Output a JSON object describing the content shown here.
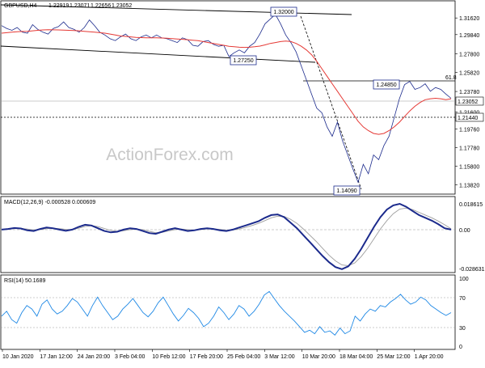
{
  "main_header": {
    "symbol": "GBPUSD,H4",
    "o": "1.22919",
    "h": "1.23071",
    "l": "1.22656",
    "c": "1.23052"
  },
  "watermark": "ActionForex.com",
  "price_axis": {
    "labels": [
      "1.31620",
      "1.29840",
      "1.27800",
      "1.25820",
      "1.23780",
      "1.21600",
      "1.19760",
      "1.17780",
      "1.15800",
      "1.13820"
    ],
    "min": 1.13,
    "max": 1.325
  },
  "time_axis": [
    "10 Jan 2020",
    "17 Jan 12:00",
    "24 Jan 20:00",
    "3 Feb 04:00",
    "10 Feb 12:00",
    "17 Feb 20:00",
    "25 Feb 04:00",
    "3 Mar 12:00",
    "10 Mar 20:00",
    "18 Mar 04:00",
    "25 Mar 12:00",
    "1 Apr 20:00"
  ],
  "callouts": {
    "high": "1.32000",
    "mid_low": "1.27250",
    "low": "1.14090",
    "recovery": "1.24850",
    "fib": "61.8"
  },
  "price_tags": {
    "current": "1.23052",
    "support": "1.21440"
  },
  "macd": {
    "title": "MACD(12,26,9) -0.000528 0.000609",
    "axis": [
      "0.018615",
      "0.00",
      "-0.028631"
    ]
  },
  "rsi": {
    "title": "RSI(14) 50.1689",
    "axis": [
      "100",
      "70",
      "30",
      "0"
    ]
  },
  "chart_data": [
    {
      "type": "line",
      "title": "GBPUSD,H4",
      "series": [
        {
          "values": [
            1.308,
            1.305,
            1.303,
            1.306,
            1.301,
            1.3,
            1.309,
            1.304,
            1.301,
            1.299,
            1.305,
            1.307,
            1.312,
            1.306,
            1.304,
            1.301,
            1.306,
            1.314,
            1.308,
            1.301,
            1.298,
            1.294,
            1.292,
            1.296,
            1.299,
            1.294,
            1.292,
            1.296,
            1.298,
            1.295,
            1.298,
            1.295,
            1.294,
            1.292,
            1.29,
            1.295,
            1.293,
            1.287,
            1.286,
            1.291,
            1.292,
            1.288,
            1.286,
            1.287,
            1.275,
            1.279,
            1.282,
            1.279,
            1.286,
            1.29,
            1.299,
            1.31,
            1.315,
            1.32,
            1.31,
            1.298,
            1.29,
            1.28,
            1.265,
            1.25,
            1.235,
            1.22,
            1.215,
            1.2,
            1.19,
            1.205,
            1.185,
            1.17,
            1.155,
            1.1409,
            1.16,
            1.15,
            1.17,
            1.165,
            1.18,
            1.19,
            1.21,
            1.23,
            1.245,
            1.2485,
            1.24,
            1.242,
            1.246,
            1.238,
            1.242,
            1.24,
            1.235,
            1.2305
          ]
        },
        {
          "values": [
            1.3,
            1.3005,
            1.301,
            1.3015,
            1.3018,
            1.302,
            1.3025,
            1.303,
            1.3034,
            1.3036,
            1.3035,
            1.3034,
            1.3032,
            1.303,
            1.3028,
            1.3025,
            1.302,
            1.3015,
            1.301,
            1.3005,
            1.3,
            1.299,
            1.298,
            1.297,
            1.2965,
            1.296,
            1.2955,
            1.2952,
            1.295,
            1.295,
            1.295,
            1.2948,
            1.2946,
            1.2942,
            1.2938,
            1.2934,
            1.293,
            1.2925,
            1.292,
            1.291,
            1.29,
            1.289,
            1.288,
            1.287,
            1.286,
            1.2855,
            1.285,
            1.2848,
            1.285,
            1.2855,
            1.2862,
            1.2875,
            1.289,
            1.29,
            1.291,
            1.2915,
            1.291,
            1.289,
            1.286,
            1.282,
            1.277,
            1.27,
            1.262,
            1.254,
            1.246,
            1.238,
            1.23,
            1.222,
            1.214,
            1.206,
            1.2,
            1.196,
            1.193,
            1.192,
            1.193,
            1.196,
            1.2,
            1.205,
            1.211,
            1.217,
            1.222,
            1.226,
            1.229,
            1.23,
            1.2305,
            1.23,
            1.229,
            1.23
          ]
        }
      ],
      "ylim": [
        1.13,
        1.325
      ]
    },
    {
      "type": "line",
      "title": "MACD(12,26,9) -0.000528 0.000609",
      "series": [
        {
          "values": [
            0.0,
            0.0005,
            0.0012,
            0.0008,
            -0.0005,
            -0.001,
            0.0005,
            0.0015,
            0.001,
            0.0,
            -0.0008,
            0.0,
            0.002,
            0.0035,
            0.003,
            0.001,
            -0.001,
            -0.002,
            -0.0015,
            0.0,
            0.001,
            0.0005,
            -0.001,
            -0.0025,
            -0.003,
            -0.0015,
            0.0,
            0.001,
            0.0,
            -0.001,
            -0.0005,
            0.0005,
            0.001,
            0.0005,
            -0.0005,
            -0.001,
            0.0,
            0.0015,
            0.003,
            0.0045,
            0.006,
            0.0085,
            0.0105,
            0.011,
            0.009,
            0.005,
            0.001,
            -0.004,
            -0.009,
            -0.014,
            -0.019,
            -0.0235,
            -0.027,
            -0.0285,
            -0.0265,
            -0.021,
            -0.014,
            -0.006,
            0.002,
            0.009,
            0.0145,
            0.0175,
            0.0186,
            0.0165,
            0.0135,
            0.0105,
            0.0085,
            0.0065,
            0.004,
            0.001,
            0.0
          ]
        },
        {
          "values": [
            0.0,
            0.0003,
            0.0007,
            0.0008,
            0.0004,
            -0.0002,
            0.0,
            0.0007,
            0.001,
            0.0007,
            0.0002,
            0.0,
            0.001,
            0.0022,
            0.0028,
            0.0022,
            0.0008,
            -0.0006,
            -0.0012,
            -0.0008,
            0.0,
            0.0004,
            0.0,
            -0.0012,
            -0.0022,
            -0.002,
            -0.001,
            0.0,
            0.0004,
            0.0,
            -0.0004,
            0.0,
            0.0005,
            0.0006,
            0.0002,
            -0.0004,
            -0.0003,
            0.0005,
            0.0016,
            0.003,
            0.0045,
            0.0065,
            0.0085,
            0.0097,
            0.0095,
            0.0075,
            0.0045,
            0.0005,
            -0.004,
            -0.0085,
            -0.0135,
            -0.0185,
            -0.0225,
            -0.0255,
            -0.026,
            -0.024,
            -0.0195,
            -0.0135,
            -0.0065,
            0.0005,
            0.0065,
            0.0115,
            0.0148,
            0.0155,
            0.0145,
            0.0125,
            0.0105,
            0.0085,
            0.0062,
            0.0035,
            0.0006
          ]
        }
      ],
      "ylim": [
        -0.028631,
        0.018615
      ]
    },
    {
      "type": "line",
      "title": "RSI(14) 50.1689",
      "series": [
        {
          "values": [
            45,
            52,
            40,
            35,
            50,
            60,
            55,
            45,
            62,
            68,
            55,
            48,
            52,
            60,
            70,
            65,
            55,
            45,
            60,
            72,
            60,
            50,
            40,
            45,
            55,
            62,
            70,
            60,
            50,
            44,
            52,
            64,
            72,
            60,
            48,
            38,
            46,
            56,
            50,
            42,
            30,
            35,
            45,
            58,
            50,
            40,
            48,
            60,
            55,
            45,
            52,
            62,
            75,
            80,
            70,
            60,
            52,
            45,
            38,
            30,
            22,
            25,
            20,
            30,
            22,
            24,
            18,
            28,
            20,
            24,
            45,
            38,
            48,
            55,
            52,
            60,
            58,
            65,
            70,
            76,
            68,
            62,
            65,
            72,
            68,
            60,
            55,
            50,
            46,
            50
          ]
        }
      ],
      "ylim": [
        0,
        100
      ]
    }
  ]
}
